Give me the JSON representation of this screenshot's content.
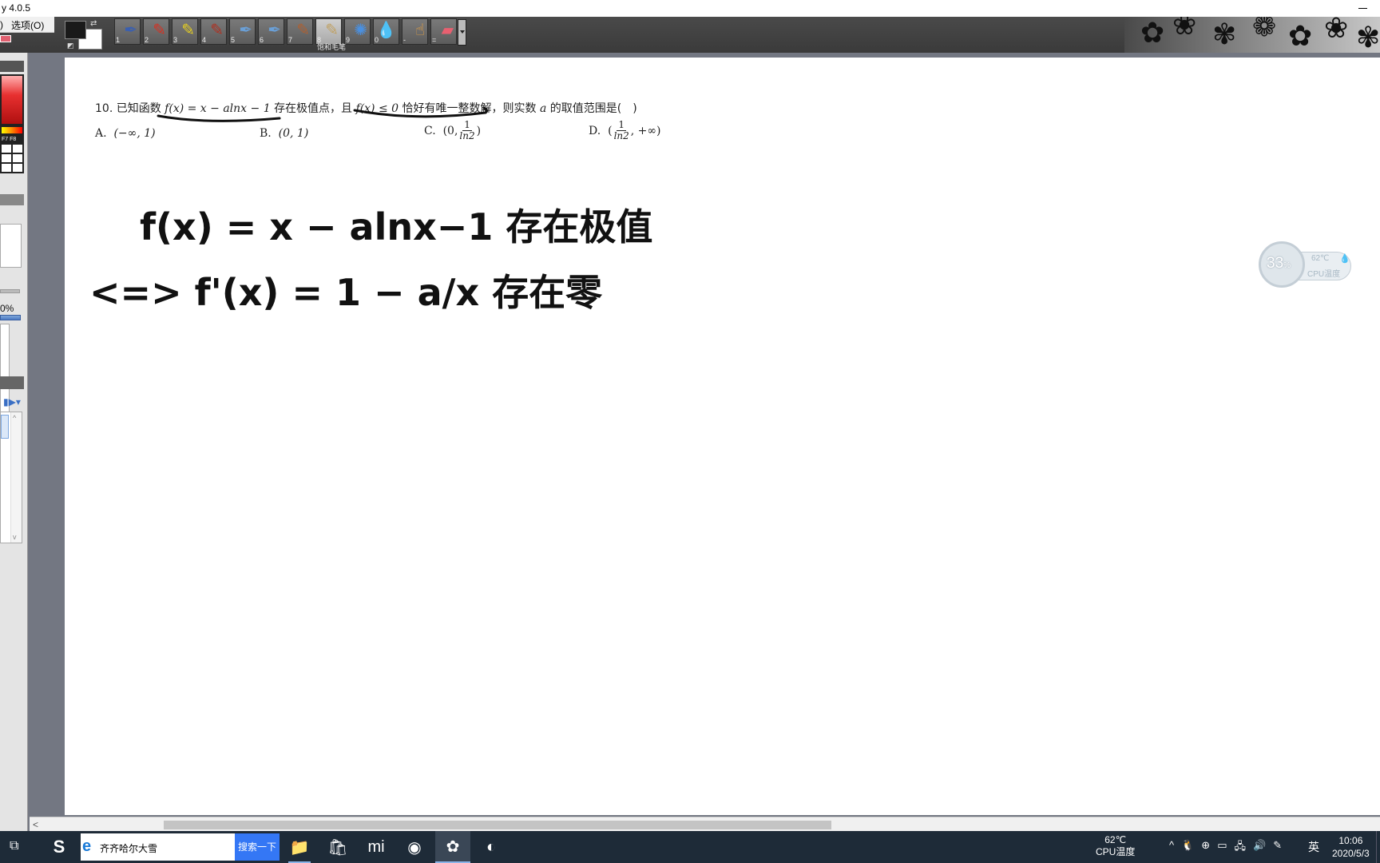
{
  "window": {
    "title": "y 4.0.5"
  },
  "menu": {
    "left_fragment": ")",
    "options_label": "选项(O)"
  },
  "toolbar": {
    "swap_icon": "⇄",
    "reset_icon": "◩",
    "tools": [
      {
        "num": "1",
        "icon": "pen-icon",
        "glyph": "✒",
        "color": "#3a5fb0"
      },
      {
        "num": "2",
        "icon": "pencil-icon",
        "glyph": "✎",
        "color": "#d83020"
      },
      {
        "num": "3",
        "icon": "highlighter-icon",
        "glyph": "✎",
        "color": "#e8d020"
      },
      {
        "num": "4",
        "icon": "marker-icon",
        "glyph": "✎",
        "color": "#b03020"
      },
      {
        "num": "5",
        "icon": "fountain-pen-icon",
        "glyph": "✒",
        "color": "#6aa0d8"
      },
      {
        "num": "6",
        "icon": "calligraphy-pen-icon",
        "glyph": "✒",
        "color": "#6aa0d8"
      },
      {
        "num": "7",
        "icon": "brush-icon",
        "glyph": "✎",
        "color": "#b06030"
      },
      {
        "num": "8",
        "icon": "saturated-brush-icon",
        "glyph": "✎",
        "color": "#c0a060",
        "active": true
      },
      {
        "num": "9",
        "icon": "spray-icon",
        "glyph": "✺",
        "color": "#4a90e0"
      },
      {
        "num": "0",
        "icon": "water-drop-icon",
        "glyph": "💧",
        "color": "#4a90e0"
      },
      {
        "num": "-",
        "icon": "finger-smudge-icon",
        "glyph": "☝",
        "color": "#e8a040"
      },
      {
        "num": "=",
        "icon": "eraser-icon",
        "glyph": "▰",
        "color": "#e86070"
      }
    ],
    "active_tool_label": "饱和毛笔"
  },
  "left_panel": {
    "fkeys_label": "F7 F8",
    "percent": "0%",
    "scroll_up": "^",
    "scroll_down": "v"
  },
  "problem": {
    "prefix": "10. 已知函数",
    "func": "f(x) = x − alnx − 1",
    "mid1": "存在极值点，且",
    "cond": "f(x) ≤ 0",
    "mid2": "恰好有唯一整数解，则实数",
    "var": "a",
    "suffix": "的取值范围是(　)"
  },
  "options": [
    {
      "label": "A.",
      "text": "(−∞, 1)"
    },
    {
      "label": "B.",
      "text": "(0, 1)"
    },
    {
      "label": "C.",
      "pre": "(0,",
      "num": "1",
      "den": "ln2",
      "post": ")"
    },
    {
      "label": "D.",
      "pre": "(",
      "num": "1",
      "den": "ln2",
      "post": ", +∞)"
    }
  ],
  "handwriting": {
    "line1": "f(x) = x − alnx−1 存在极值",
    "line2": "<=> f'(x) = 1 − a/x 存在零"
  },
  "scrollbar": {
    "left_arrow": "<"
  },
  "cpu_widget": {
    "usage": "33",
    "usage_unit": "%",
    "temp": "62℃",
    "label": "CPU温度"
  },
  "taskbar": {
    "taskview_icon": "⧉",
    "s_icon": "S",
    "search_text": "齐齐哈尔大雪",
    "search_button": "搜索一下",
    "apps": [
      {
        "name": "file-explorer-icon",
        "glyph": "📁",
        "running": true
      },
      {
        "name": "store-icon",
        "glyph": "🛍"
      },
      {
        "name": "mi-icon",
        "glyph": "mi"
      },
      {
        "name": "browser-360-icon",
        "glyph": "◉"
      },
      {
        "name": "paint-app-icon",
        "glyph": "✿",
        "active": true
      },
      {
        "name": "firefox-icon",
        "glyph": "◐"
      }
    ],
    "cpu_temp": "62℃",
    "cpu_label": "CPU温度",
    "tray_icons": [
      "^",
      "🐧",
      "⊕",
      "▭",
      "🖧",
      "🔊",
      "✎"
    ],
    "ime": "英",
    "time": "10:06",
    "date": "2020/5/3"
  }
}
